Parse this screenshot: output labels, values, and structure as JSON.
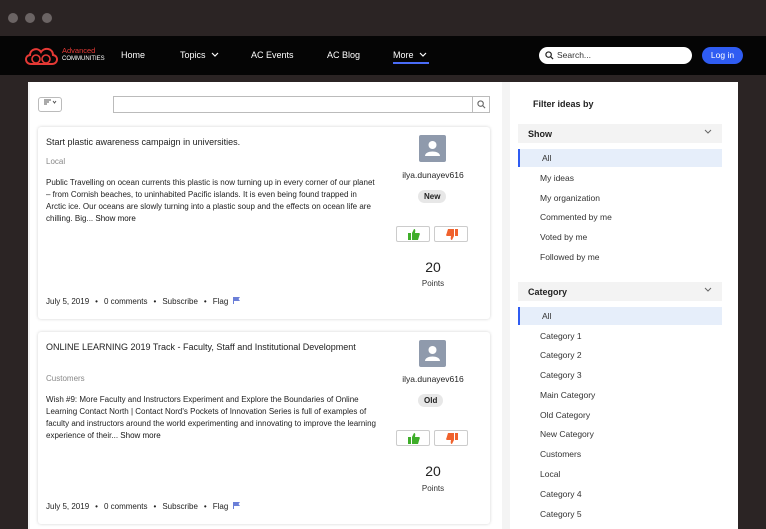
{
  "logo": {
    "line1": "Advanced",
    "line2": "COMMUNITIES"
  },
  "nav": {
    "home": "Home",
    "topics": "Topics",
    "events": "AC Events",
    "blog": "AC Blog",
    "more": "More"
  },
  "search": {
    "placeholder": "Search..."
  },
  "login_label": "Log in",
  "ideas": [
    {
      "title": "Start plastic awareness campaign in universities.",
      "category": "Local",
      "body": "Public Travelling on ocean currents this plastic is now turning up in every corner of our planet – from Cornish beaches, to uninhabited Pacific islands. It is even being found trapped in Arctic ice. Our oceans are slowly turning into a plastic soup and the effects on ocean life are chilling. Big...",
      "show_more": "Show more",
      "author": "ilya.dunayev616",
      "status": "New",
      "points": "20",
      "points_label": "Points",
      "date": "July 5, 2019",
      "comments": "0 comments",
      "subscribe": "Subscribe",
      "flag": "Flag"
    },
    {
      "title": "ONLINE LEARNING 2019 Track - Faculty, Staff and Institutional Development",
      "category": "Customers",
      "body": "Wish #9: More Faculty and Instructors Experiment and Explore the Boundaries of Online Learning Contact North | Contact Nord's Pockets of Innovation Series is full of examples of faculty and instructors around the world experimenting and innovating to improve the learning experience of their...",
      "show_more": "Show more",
      "author": "ilya.dunayev616",
      "status": "Old",
      "points": "20",
      "points_label": "Points",
      "date": "July 5, 2019",
      "comments": "0 comments",
      "subscribe": "Subscribe",
      "flag": "Flag"
    }
  ],
  "sidebar": {
    "title": "Filter ideas by",
    "show": {
      "label": "Show",
      "items": [
        "All",
        "My ideas",
        "My organization",
        "Commented by me",
        "Voted by me",
        "Followed by me"
      ]
    },
    "category": {
      "label": "Category",
      "items": [
        "All",
        "Category 1",
        "Category 2",
        "Category 3",
        "Main Category",
        "Old Category",
        "New Category",
        "Customers",
        "Local",
        "Category 4",
        "Category 5"
      ]
    }
  },
  "colors": {
    "accent": "#2f5cf2",
    "upvote": "#3fae2a",
    "downvote": "#f0622d"
  }
}
